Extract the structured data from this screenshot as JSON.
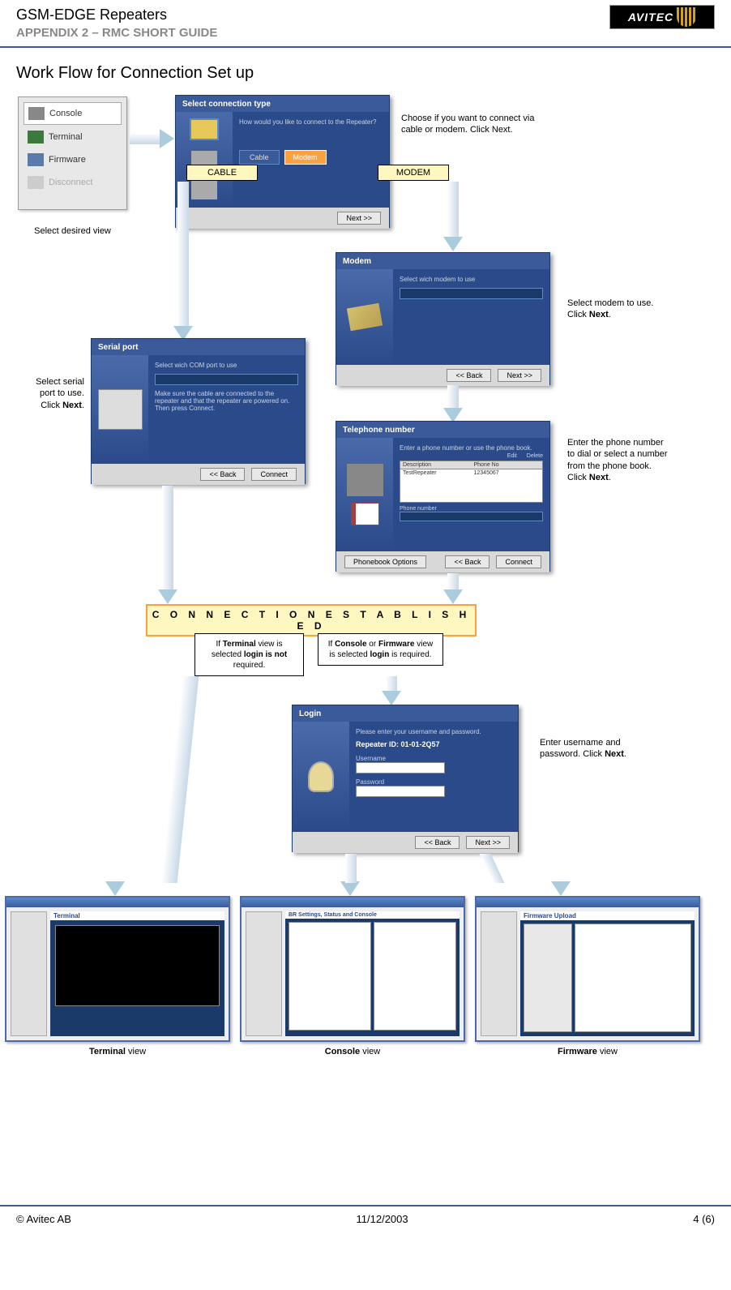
{
  "header": {
    "title": "GSM-EDGE Repeaters",
    "subtitle": "APPENDIX 2 – RMC SHORT GUIDE",
    "logo": "AVITEC"
  },
  "section_title": "Work Flow for Connection Set up",
  "sidebar": {
    "items": [
      "Console",
      "Terminal",
      "Firmware",
      "Disconnect"
    ],
    "caption": "Select desired view"
  },
  "wizard": {
    "conn_type": {
      "title": "Select connection type",
      "desc": "How would you like to connect to the Repeater?",
      "note": "Choose if you want to connect via cable or modem. Click Next.",
      "btn_cable": "Cable",
      "btn_modem": "Modem"
    },
    "labels": {
      "cable": "CABLE",
      "modem": "MODEM"
    },
    "serial": {
      "title": "Serial port",
      "desc": "Select wich COM port to use",
      "desc2": "Make sure the cable are connected to the repeater and that the repeater are powered on. Then press Connect.",
      "note": "Select serial port to use. Click Next."
    },
    "modem": {
      "title": "Modem",
      "desc": "Select wich modem to use",
      "note": "Select modem to use. Click ",
      "note_b": "Next",
      "note_end": "."
    },
    "phone": {
      "title": "Telephone number",
      "desc": "Enter a phone number or use the phone book.",
      "note": "Enter the phone number to dial or select a number from the phone book. Click ",
      "note_b": "Next",
      "note_end": ".",
      "col1": "Description",
      "col2": "Phone No",
      "row1": "TestRepeater",
      "row2": "12345067"
    },
    "login": {
      "title": "Login",
      "desc": "Please enter your username and password.",
      "id": "Repeater ID: 01-01-2Q57",
      "u": "Username",
      "p": "Password",
      "note": "Enter username and password. Click Next."
    }
  },
  "conn_established": "C O N N E C T I O N   E S T A B L I S H E D",
  "notes": {
    "terminal": [
      "If ",
      "Terminal",
      " view is selected ",
      "login is not",
      " required."
    ],
    "console": [
      "If ",
      "Console",
      " or ",
      "Firmware",
      " view is selected ",
      "login",
      " is required."
    ]
  },
  "views": {
    "terminal": "Terminal",
    "terminal_v": " view",
    "console": "Console",
    "console_v": " view",
    "firmware": "Firmware",
    "firmware_v": " view",
    "t_title": "Terminal",
    "c_title": "BR Settings, Status and Console",
    "f_title": "Firmware Upload"
  },
  "btns": {
    "back": "<< Back",
    "next": "Next >>",
    "connect": "Connect",
    "phonebook": "Phonebook Options",
    "edit": "Edit",
    "delete": "Delete"
  },
  "footer": {
    "copyright": "© Avitec AB",
    "date": "11/12/2003",
    "page": "4 (6)"
  }
}
